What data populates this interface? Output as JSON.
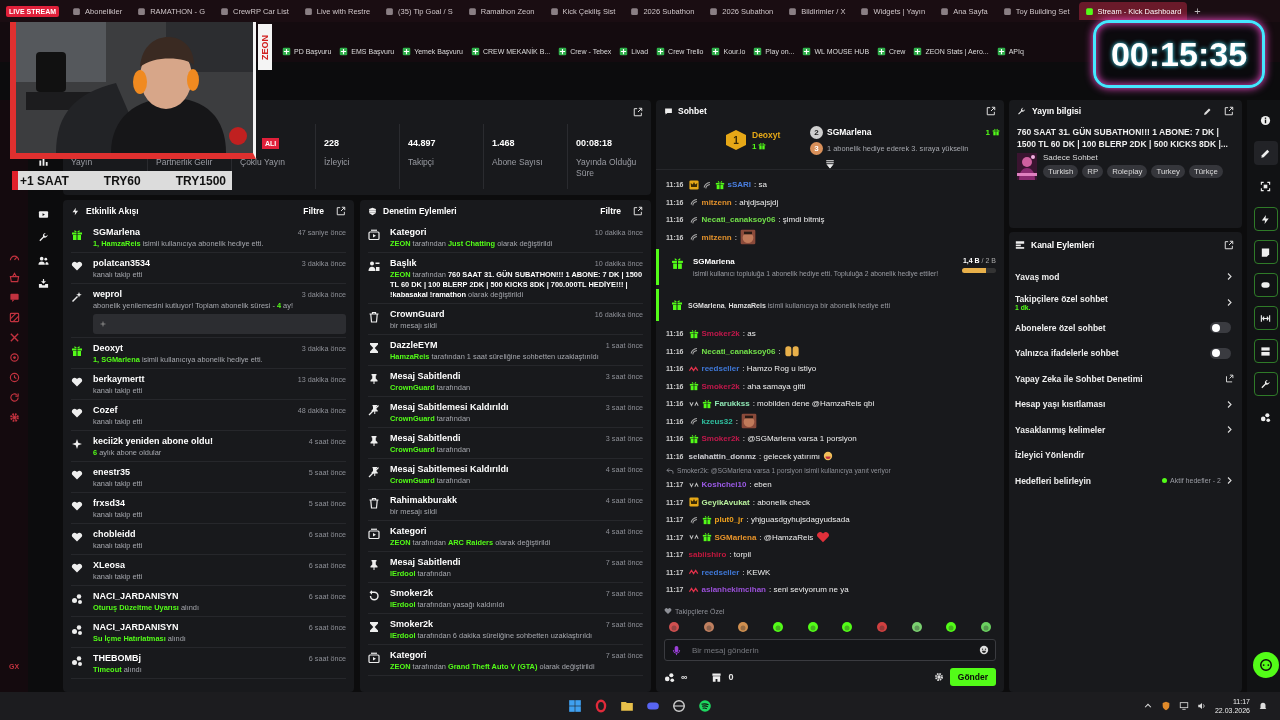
{
  "browser": {
    "live_badge": "LIVE STREAM",
    "tabs": [
      {
        "label": "Abonelikler",
        "selected": false
      },
      {
        "label": "RAMATHON - G",
        "selected": false
      },
      {
        "label": "CrewRP Car List",
        "selected": false
      },
      {
        "label": "Live with Restre",
        "selected": false
      },
      {
        "label": "(35) Tip Goal / S",
        "selected": false
      },
      {
        "label": "Ramathon Zeon",
        "selected": false
      },
      {
        "label": "Kick Çekiliş Sist",
        "selected": false
      },
      {
        "label": "2026 Subathon",
        "selected": false
      },
      {
        "label": "2026 Subathon",
        "selected": false
      },
      {
        "label": "Bildirimler / X",
        "selected": false
      },
      {
        "label": "Widgets | Yayın",
        "selected": false
      },
      {
        "label": "Ana Sayfa",
        "selected": false
      },
      {
        "label": "Toy Building Set",
        "selected": false
      },
      {
        "label": "Stream - Kick Dashboard",
        "selected": true
      }
    ],
    "new_tab": "+",
    "bookmarks": [
      "PD Başvuru",
      "EMS Başvuru",
      "Yemek Başvuru",
      "CREW MEKANİK B...",
      "Crew - Tebex",
      "Livad",
      "Crew Trello",
      "Kour.io",
      "Play on...",
      "WL MOUSE HUB",
      "Crew",
      "ZEON Stats | Aero...",
      "APIq"
    ]
  },
  "overlay": {
    "cam_label": "ZEON",
    "bar": [
      "+1 SAAT",
      "TRY60",
      "TRY1500"
    ],
    "timer": "00:15:35"
  },
  "left_rail": {
    "brand": "GX"
  },
  "stats": {
    "tiles": [
      {
        "label": "Yayın"
      },
      {
        "label": "Partnerlik Gelir"
      },
      {
        "badge": "ALI",
        "label": "Çoklu Yayın"
      },
      {
        "value": "228",
        "label": "İzleyici"
      },
      {
        "value": "44.897",
        "label": "Takipçi"
      },
      {
        "value": "1.468",
        "label": "Abone Sayısı"
      },
      {
        "value": "00:08:18",
        "label": "Yayında Olduğu Süre"
      }
    ]
  },
  "activity": {
    "title": "Etkinlik Akışı",
    "filter": "Filtre",
    "items": [
      {
        "kind": "gift",
        "user": "SGMarlena",
        "time": "47 saniye önce",
        "detail": [
          {
            "kind": "name",
            "text": "1, HamzaReis"
          },
          {
            "kind": "text",
            "text": " isimli kullanıcıya abonelik hediye etti."
          }
        ]
      },
      {
        "kind": "follow",
        "user": "polatcan3534",
        "time": "3 dakika önce",
        "detail": [
          {
            "kind": "text",
            "text": "kanalı takip etti"
          }
        ]
      },
      {
        "kind": "resub",
        "user": "weprol",
        "time": "3 dakika önce",
        "detail": [
          {
            "kind": "text",
            "text": "abonelik yenilemesini kutluyor! Toplam abonelik süresi - "
          },
          {
            "kind": "name",
            "text": "4"
          },
          {
            "kind": "text",
            "text": " ay!"
          }
        ]
      },
      {
        "kind": "gift",
        "user": "Deoxyt",
        "time": "3 dakika önce",
        "detail": [
          {
            "kind": "name",
            "text": "1, SGMarlena"
          },
          {
            "kind": "text",
            "text": " isimli kullanıcıya abonelik hediye etti."
          }
        ]
      },
      {
        "kind": "follow",
        "user": "berkaymertt",
        "time": "13 dakika önce",
        "detail": [
          {
            "kind": "text",
            "text": "kanalı takip etti"
          }
        ]
      },
      {
        "kind": "follow",
        "user": "Cozef",
        "time": "48 dakika önce",
        "detail": [
          {
            "kind": "text",
            "text": "kanalı takip etti"
          }
        ]
      },
      {
        "kind": "sub",
        "user": "kecii2k yeniden abone oldu!",
        "time": "4 saat önce",
        "detail": [
          {
            "kind": "name",
            "text": "6"
          },
          {
            "kind": "text",
            "text": " aylık abone oldular"
          }
        ]
      },
      {
        "kind": "follow",
        "user": "enestr35",
        "time": "5 saat önce",
        "detail": [
          {
            "kind": "text",
            "text": "kanalı takip etti"
          }
        ]
      },
      {
        "kind": "follow",
        "user": "frxsd34",
        "time": "5 saat önce",
        "detail": [
          {
            "kind": "text",
            "text": "kanalı takip etti"
          }
        ]
      },
      {
        "kind": "follow",
        "user": "chobleidd",
        "time": "6 saat önce",
        "detail": [
          {
            "kind": "text",
            "text": "kanalı takip etti"
          }
        ]
      },
      {
        "kind": "follow",
        "user": "XLeosa",
        "time": "6 saat önce",
        "detail": [
          {
            "kind": "text",
            "text": "kanalı takip etti"
          }
        ]
      },
      {
        "kind": "reward",
        "user": "NACI_JARDANISYN",
        "time": "6 saat önce",
        "detail": [
          {
            "kind": "name",
            "text": "Oturuş Düzeltme Uyarısı"
          },
          {
            "kind": "text",
            "text": " alındı"
          }
        ]
      },
      {
        "kind": "reward",
        "user": "NACI_JARDANISYN",
        "time": "6 saat önce",
        "detail": [
          {
            "kind": "name",
            "text": "Su İçme Hatırlatması"
          },
          {
            "kind": "text",
            "text": " alındı"
          }
        ]
      },
      {
        "kind": "reward",
        "user": "THEBOMBj",
        "time": "6 saat önce",
        "detail": [
          {
            "kind": "name",
            "text": "Timeout"
          },
          {
            "kind": "text",
            "text": " alındı"
          }
        ]
      }
    ]
  },
  "moderation": {
    "title": "Denetim Eylemleri",
    "filter": "Filtre",
    "items": [
      {
        "kind": "category",
        "user": "Kategori",
        "time": "10 dakika önce",
        "detail": [
          {
            "kind": "name",
            "text": "ZEON"
          },
          {
            "kind": "text",
            "text": " tarafından "
          },
          {
            "kind": "name",
            "text": "Just Chatting"
          },
          {
            "kind": "text",
            "text": " olarak değiştirildi"
          }
        ]
      },
      {
        "kind": "title",
        "user": "Başlık",
        "time": "10 dakika önce",
        "detail": [
          {
            "kind": "name",
            "text": "ZEON"
          },
          {
            "kind": "text",
            "text": " tarafından "
          },
          {
            "kind": "value",
            "text": "760 SAAT 31. GÜN SUBATHON!!! 1 ABONE: 7 DK | 1500 TL 60 DK | 100 BLERP 2DK | 500 KICKS 8DK | 700.000TL HEDİYE!!! | !kabasakal !ramathon"
          },
          {
            "kind": "text",
            "text": " olarak değiştirildi"
          }
        ]
      },
      {
        "kind": "delete",
        "user": "CrownGuard",
        "time": "16 dakika önce",
        "detail": [
          {
            "kind": "text",
            "text": "bir mesajı sildi"
          }
        ]
      },
      {
        "kind": "timeout",
        "user": "DazzleEYM",
        "time": "1 saat önce",
        "detail": [
          {
            "kind": "name",
            "text": "HamzaReis"
          },
          {
            "kind": "text",
            "text": " tarafından 1 saat süreliğine sohbetten uzaklaştırıldı"
          }
        ]
      },
      {
        "kind": "pin",
        "user": "Mesaj Sabitlendi",
        "time": "3 saat önce",
        "detail": [
          {
            "kind": "name",
            "text": "CrownGuard"
          },
          {
            "kind": "text",
            "text": " tarafından"
          }
        ]
      },
      {
        "kind": "unpin",
        "user": "Mesaj Sabitlemesi Kaldırıldı",
        "time": "3 saat önce",
        "detail": [
          {
            "kind": "name",
            "text": "CrownGuard"
          },
          {
            "kind": "text",
            "text": " tarafından"
          }
        ]
      },
      {
        "kind": "pin",
        "user": "Mesaj Sabitlendi",
        "time": "3 saat önce",
        "detail": [
          {
            "kind": "name",
            "text": "CrownGuard"
          },
          {
            "kind": "text",
            "text": " tarafından"
          }
        ]
      },
      {
        "kind": "unpin",
        "user": "Mesaj Sabitlemesi Kaldırıldı",
        "time": "4 saat önce",
        "detail": [
          {
            "kind": "name",
            "text": "CrownGuard"
          },
          {
            "kind": "text",
            "text": " tarafından"
          }
        ]
      },
      {
        "kind": "delete",
        "user": "Rahimakburakk",
        "time": "4 saat önce",
        "detail": [
          {
            "kind": "text",
            "text": "bir mesajı sildi"
          }
        ]
      },
      {
        "kind": "category",
        "user": "Kategori",
        "time": "4 saat önce",
        "detail": [
          {
            "kind": "name",
            "text": "ZEON"
          },
          {
            "kind": "text",
            "text": " tarafından "
          },
          {
            "kind": "name",
            "text": "ARC Raiders"
          },
          {
            "kind": "text",
            "text": " olarak değiştirildi"
          }
        ]
      },
      {
        "kind": "pin",
        "user": "Mesaj Sabitlendi",
        "time": "7 saat önce",
        "detail": [
          {
            "kind": "name",
            "text": "lErdool"
          },
          {
            "kind": "text",
            "text": " tarafından"
          }
        ]
      },
      {
        "kind": "unban",
        "user": "Smoker2k",
        "time": "7 saat önce",
        "detail": [
          {
            "kind": "name",
            "text": "lErdool"
          },
          {
            "kind": "text",
            "text": " tarafından yasağı kaldırıldı"
          }
        ]
      },
      {
        "kind": "timeout",
        "user": "Smoker2k",
        "time": "7 saat önce",
        "detail": [
          {
            "kind": "name",
            "text": "lErdool"
          },
          {
            "kind": "text",
            "text": " tarafından 6 dakika süreliğine sohbetten uzaklaştırıldı"
          }
        ]
      },
      {
        "kind": "category",
        "user": "Kategori",
        "time": "7 saat önce",
        "detail": [
          {
            "kind": "name",
            "text": "ZEON"
          },
          {
            "kind": "text",
            "text": " tarafından "
          },
          {
            "kind": "name",
            "text": "Grand Theft Auto V (GTA)"
          },
          {
            "kind": "text",
            "text": " olarak değiştirildi"
          }
        ]
      }
    ]
  },
  "chat": {
    "title": "Sohbet",
    "leaderboard": {
      "first": {
        "rank": "1",
        "user": "Deoxyt",
        "count": "1"
      },
      "second": {
        "rank": "2",
        "user": "SGMarlena",
        "count": "1"
      },
      "third": {
        "rank": "3",
        "text": "1 abonelik hediye ederek 3. sıraya yükselin"
      }
    },
    "messages": [
      {
        "kind": "message",
        "time": "11:16",
        "badges": [
          {
            "kind": "crown"
          },
          {
            "kind": "tier"
          },
          {
            "kind": "gift"
          }
        ],
        "user": "sSARI",
        "color": "#4a7fe0",
        "text": ": sa"
      },
      {
        "kind": "message",
        "time": "11:16",
        "badges": [
          {
            "kind": "tier"
          }
        ],
        "user": "mitzenn",
        "color": "#e0902c",
        "text": ": ahjdjsajsjdj"
      },
      {
        "kind": "message",
        "time": "11:16",
        "badges": [
          {
            "kind": "tier"
          }
        ],
        "user": "Necati_canaksoy06",
        "color": "#72e04a",
        "text": ": şimdi bitmiş"
      },
      {
        "kind": "message",
        "time": "11:16",
        "badges": [
          {
            "kind": "tier"
          }
        ],
        "user": "mitzenn",
        "color": "#e0902c",
        "text": ":",
        "emote": {
          "kind": "meme"
        }
      },
      {
        "kind": "gift_event",
        "user": "SGMarlena",
        "text": "isimli kullanıcı topluluğa 1 abonelik hediye etti. Topluluğa 2 abonelik hediye ettiler!",
        "reading": "**1,4 B** / 2 B",
        "level": 0.7
      },
      {
        "kind": "gift_single",
        "text": "**SGMarlena**, **HamzaReis** isimli kullanıcıya bir abonelik hediye etti"
      },
      {
        "kind": "message",
        "time": "11:16",
        "badges": [
          {
            "kind": "gift"
          }
        ],
        "user": "Smoker2k",
        "color": "#c2184c",
        "text": ": as"
      },
      {
        "kind": "message",
        "time": "11:16",
        "badges": [
          {
            "kind": "tier"
          }
        ],
        "user": "Necati_canaksoy06",
        "color": "#72e04a",
        "text": ":",
        "emote": {
          "kind": "letters"
        }
      },
      {
        "kind": "message",
        "time": "11:16",
        "badges": [
          {
            "kind": "wave"
          }
        ],
        "user": "reedseller",
        "color": "#3f78d8",
        "text": ": Hamzo Rog u istiyo"
      },
      {
        "kind": "message",
        "time": "11:16",
        "badges": [
          {
            "kind": "gift"
          }
        ],
        "user": "Smoker2k",
        "color": "#c2184c",
        "text": ": aha samaya gitti"
      },
      {
        "kind": "message",
        "time": "11:16",
        "badges": [
          {
            "kind": "va"
          },
          {
            "kind": "gift"
          }
        ],
        "user": "Farukkss",
        "color": "#8fe6b4",
        "text": ": mobilden dene @HamzaReis qbi"
      },
      {
        "kind": "message",
        "time": "11:16",
        "badges": [
          {
            "kind": "tier"
          }
        ],
        "user": "kzeus32",
        "color": "#2fbf9f",
        "text": ":",
        "emote": {
          "kind": "meme"
        }
      },
      {
        "kind": "message",
        "time": "11:16",
        "badges": [
          {
            "kind": "gift"
          }
        ],
        "user": "Smoker2k",
        "color": "#c2184c",
        "text": ": @SGMarlena varsa 1 porsiyon"
      },
      {
        "kind": "message",
        "time": "11:16",
        "user": "selahattin_donmz",
        "color": "#d0d0d6",
        "text": ": gelecek yatırımı",
        "emote": {
          "kind": "laugh"
        }
      },
      {
        "kind": "reply",
        "text": "Smoker2k: @SGMarlena varsa 1 porsiyon isimli kullanıcıya yanıt veriyor"
      },
      {
        "kind": "message",
        "time": "11:17",
        "badges": [
          {
            "kind": "va"
          }
        ],
        "user": "Koshchei10",
        "color": "#9b5ae6",
        "text": ": eben"
      },
      {
        "kind": "message",
        "time": "11:17",
        "badges": [
          {
            "kind": "crown"
          }
        ],
        "user": "GeyikAvukat",
        "color": "#b8f09c",
        "text": ": abonelik check"
      },
      {
        "kind": "message",
        "time": "11:17",
        "badges": [
          {
            "kind": "tier"
          },
          {
            "kind": "gift"
          }
        ],
        "user": "plut0_jr",
        "color": "#f0a21e",
        "text": ": yhjguasdgyhujsdagyudsada"
      },
      {
        "kind": "message",
        "time": "11:17",
        "badges": [
          {
            "kind": "va"
          },
          {
            "kind": "gift"
          }
        ],
        "user": "SGMarlena",
        "color": "#e8942a",
        "text": ": @HamzaReis",
        "emote": {
          "kind": "heart"
        }
      },
      {
        "kind": "message",
        "time": "11:17",
        "user": "sabiishiro",
        "color": "#c2183e",
        "text": ": torpil"
      },
      {
        "kind": "message",
        "time": "11:17",
        "badges": [
          {
            "kind": "wave"
          }
        ],
        "user": "reedseller",
        "color": "#3f78d8",
        "text": ": KEWK"
      },
      {
        "kind": "message",
        "time": "11:17",
        "badges": [
          {
            "kind": "wave"
          }
        ],
        "user": "aslanhekimcihan",
        "color": "#9a50d8",
        "text": ": seni seviyorum ne ya"
      }
    ],
    "emote_section": "Takipçilere Özel",
    "placeholder": "Bir mesaj gönderin",
    "points": "∞",
    "cart_count": "0",
    "send": "Gönder"
  },
  "stream_info": {
    "title": "Yayın bilgisi",
    "stream_title": "760 SAAT 31. GÜN SUBATHON!!! 1 ABONE: 7 DK | 1500 TL 60 DK | 100 BLERP 2DK | 500 KICKS 8DK |...",
    "category": "Sadece Sohbet",
    "tags": [
      "Turkish",
      "RP",
      "Roleplay",
      "Turkey",
      "Türkçe"
    ]
  },
  "channel_actions": {
    "title": "Kanal Eylemleri",
    "items": [
      {
        "kind": "arrow",
        "label": "Yavaş mod"
      },
      {
        "kind": "arrow",
        "label": "Takipçilere özel sohbet",
        "sub": "1 dk."
      },
      {
        "kind": "toggle",
        "label": "Abonelere özel sohbet",
        "on": false
      },
      {
        "kind": "toggle",
        "label": "Yalnızca ifadelerle sohbet",
        "on": false
      },
      {
        "kind": "external",
        "label": "Yapay Zeka ile Sohbet Denetimi"
      },
      {
        "kind": "arrow",
        "label": "Hesap yaşı kısıtlaması"
      },
      {
        "kind": "arrow",
        "label": "Yasaklanmış kelimeler"
      },
      {
        "kind": "plain",
        "label": "İzleyici Yönlendir"
      },
      {
        "kind": "arrow",
        "label": "Hedefleri belirleyin",
        "status": "Aktif hedefler - 2"
      }
    ]
  },
  "taskbar": {
    "time": "11:17",
    "date": "22.03.2026"
  }
}
